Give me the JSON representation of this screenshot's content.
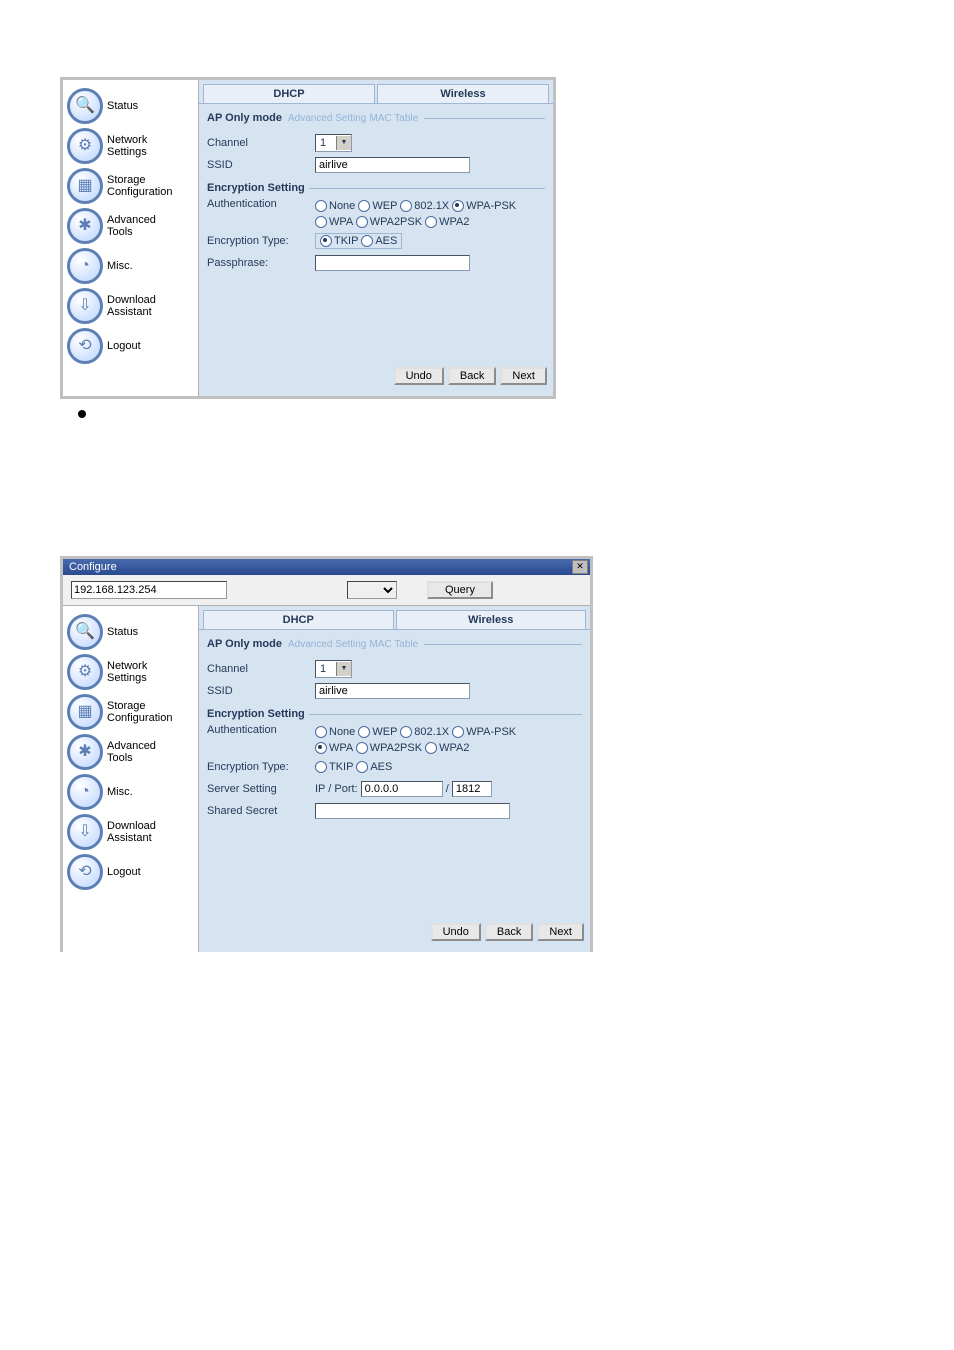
{
  "sidebar": {
    "items": [
      {
        "label": "Status",
        "icon": "🔍"
      },
      {
        "label": "Network\nSettings",
        "icon": "⚙"
      },
      {
        "label": "Storage\nConfiguration",
        "icon": "▦"
      },
      {
        "label": "Advanced\nTools",
        "icon": "✱"
      },
      {
        "label": "Misc.",
        "icon": "◔"
      },
      {
        "label": "Download\nAssistant",
        "icon": "⇩"
      },
      {
        "label": "Logout",
        "icon": "⟲"
      }
    ]
  },
  "tabs": {
    "dhcp": "DHCP",
    "wireless": "Wireless"
  },
  "mode": {
    "label": "AP Only mode",
    "adv": "Advanced Setting",
    "mac": "MAC Table"
  },
  "fields": {
    "channel_label": "Channel",
    "channel_value": "1",
    "ssid_label": "SSID",
    "ssid_value": "airlive",
    "enc_title": "Encryption Setting",
    "auth_label": "Authentication",
    "enctype_label": "Encryption Type:",
    "pass_label": "Passphrase:",
    "server_label": "Server Setting",
    "server_prefix": "IP / Port:",
    "server_ip": "0.0.0.0",
    "server_sep": "/",
    "server_port": "1812",
    "shared_label": "Shared Secret"
  },
  "auth_opts": {
    "none": "None",
    "wep": "WEP",
    "dot1x": "802.1X",
    "wpapsk": "WPA-PSK",
    "wpa": "WPA",
    "wpa2psk": "WPA2PSK",
    "wpa2": "WPA2"
  },
  "enc_opts": {
    "tkip": "TKIP",
    "aes": "AES"
  },
  "buttons": {
    "undo": "Undo",
    "back": "Back",
    "next": "Next",
    "query": "Query"
  },
  "second_panel": {
    "title": "Configure",
    "ip_value": "192.168.123.254"
  }
}
